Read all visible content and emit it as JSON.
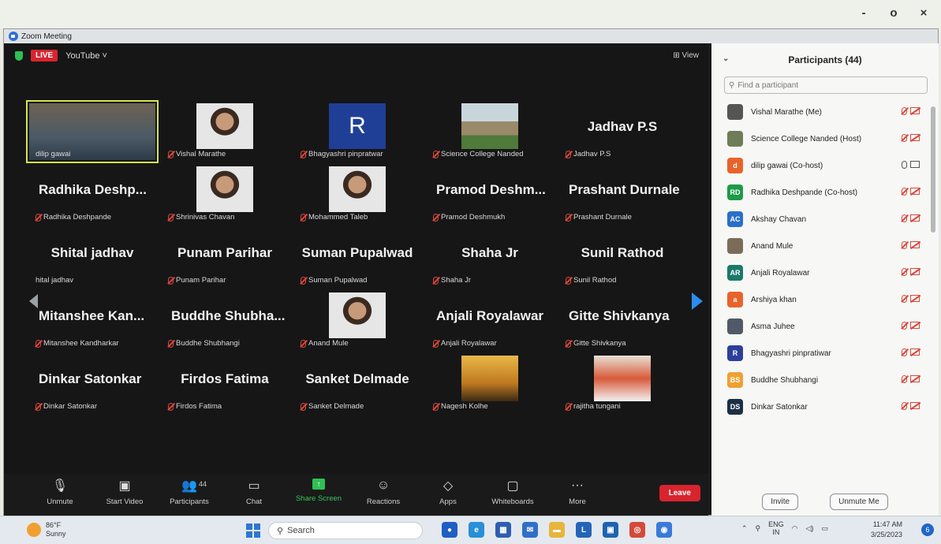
{
  "window": {
    "title": "Zoom Meeting",
    "controls": {
      "minimize": "-",
      "maximize": "o",
      "close": "×"
    }
  },
  "meeting": {
    "live_badge": "LIVE",
    "stream_target": "YouTube ˅",
    "view_label": "⊞ View"
  },
  "grid": {
    "tiles": [
      {
        "type": "video",
        "photo": "self",
        "label": "dilip gawai",
        "active": true,
        "muted": false
      },
      {
        "type": "video",
        "photo": "face",
        "label": "Vishal Marathe",
        "muted": true
      },
      {
        "type": "video",
        "photo": "letter-r",
        "letter": "R",
        "label": "Bhagyashri pinpratwar",
        "muted": true
      },
      {
        "type": "video",
        "photo": "building",
        "label": "Science College Nanded",
        "muted": true
      },
      {
        "type": "name",
        "name": "Jadhav P.S",
        "center": true,
        "label": "Jadhav P.S",
        "muted": true
      },
      {
        "type": "name",
        "name": "Radhika Deshp...",
        "label": "Radhika Deshpande",
        "muted": true
      },
      {
        "type": "video",
        "photo": "face",
        "label": "Shrinivas Chavan",
        "muted": true
      },
      {
        "type": "video",
        "photo": "face",
        "label": "Mohammed Taleb",
        "muted": true
      },
      {
        "type": "name",
        "name": "Pramod Deshm...",
        "label": "Pramod Deshmukh",
        "muted": true
      },
      {
        "type": "name",
        "name": "Prashant Durnale",
        "label": "Prashant Durnale",
        "muted": true
      },
      {
        "type": "name",
        "name": "Shital jadhav",
        "center": true,
        "label": "hital jadhav",
        "muted": false
      },
      {
        "type": "name",
        "name": "Punam Parihar",
        "center": true,
        "label": "Punam Parihar",
        "muted": true
      },
      {
        "type": "name",
        "name": "Suman Pupalwad",
        "center": true,
        "label": "Suman Pupalwad",
        "muted": true
      },
      {
        "type": "name",
        "name": "Shaha Jr",
        "center": true,
        "label": "Shaha Jr",
        "muted": true
      },
      {
        "type": "name",
        "name": "Sunil Rathod",
        "center": true,
        "label": "Sunil Rathod",
        "muted": true
      },
      {
        "type": "name",
        "name": "Mitanshee Kan...",
        "label": "Mitanshee Kandharkar",
        "muted": true
      },
      {
        "type": "name",
        "name": "Buddhe Shubha...",
        "label": "Buddhe Shubhangi",
        "muted": true
      },
      {
        "type": "video",
        "photo": "face",
        "label": "Anand Mule",
        "muted": true
      },
      {
        "type": "name",
        "name": "Anjali Royalawar",
        "label": "Anjali Royalawar",
        "muted": true
      },
      {
        "type": "name",
        "name": "Gitte Shivkanya",
        "label": "Gitte Shivkanya",
        "muted": true
      },
      {
        "type": "name",
        "name": "Dinkar Satonkar",
        "label": "Dinkar Satonkar",
        "muted": true
      },
      {
        "type": "name",
        "name": "Firdos Fatima",
        "center": true,
        "label": "Firdos Fatima",
        "muted": true
      },
      {
        "type": "name",
        "name": "Sanket Delmade",
        "center": true,
        "label": "Sanket Delmade",
        "muted": true
      },
      {
        "type": "video",
        "photo": "karate",
        "label": "Nagesh Kolhe",
        "muted": true
      },
      {
        "type": "video",
        "photo": "stage",
        "label": "rajitha tungani",
        "muted": true
      }
    ]
  },
  "toolbar": {
    "items": [
      {
        "name": "unmute",
        "icon": "🎙",
        "label": "Unmute"
      },
      {
        "name": "start-video",
        "icon": "▣",
        "label": "Start Video"
      },
      {
        "name": "participants",
        "icon": "👥",
        "label": "Participants",
        "count": "44"
      },
      {
        "name": "chat",
        "icon": "▭",
        "label": "Chat"
      },
      {
        "name": "share-screen",
        "icon": "↑",
        "label": "Share Screen"
      },
      {
        "name": "reactions",
        "icon": "☺",
        "label": "Reactions"
      },
      {
        "name": "apps",
        "icon": "◇",
        "label": "Apps"
      },
      {
        "name": "whiteboards",
        "icon": "▢",
        "label": "Whiteboards"
      },
      {
        "name": "more",
        "icon": "···",
        "label": "More"
      }
    ],
    "leave_label": "Leave"
  },
  "participants_panel": {
    "title": "Participants (44)",
    "search_placeholder": "Find a participant",
    "items": [
      {
        "name": "Vishal Marathe (Me)",
        "avatar": "",
        "color": "#555555",
        "mic": "muted",
        "cam": "off"
      },
      {
        "name": "Science College Nanded (Host)",
        "avatar": "",
        "color": "#6f7c5a",
        "mic": "muted",
        "cam": "off"
      },
      {
        "name": "dilip gawai (Co-host)",
        "avatar": "d",
        "color": "#e8632b",
        "mic": "on",
        "cam": "on"
      },
      {
        "name": "Radhika Deshpande (Co-host)",
        "avatar": "RD",
        "color": "#1e9a4a",
        "mic": "muted",
        "cam": "off"
      },
      {
        "name": "Akshay Chavan",
        "avatar": "AC",
        "color": "#2a6fc9",
        "mic": "muted",
        "cam": "off"
      },
      {
        "name": "Anand Mule",
        "avatar": "",
        "color": "#7b6c5a",
        "mic": "muted",
        "cam": "off"
      },
      {
        "name": "Anjali Royalawar",
        "avatar": "AR",
        "color": "#1a7a6a",
        "mic": "muted",
        "cam": "off"
      },
      {
        "name": "Arshiya khan",
        "avatar": "a",
        "color": "#e8632b",
        "mic": "muted",
        "cam": "off"
      },
      {
        "name": "Asma Juhee",
        "avatar": "",
        "color": "#4f5a66",
        "mic": "muted",
        "cam": "off"
      },
      {
        "name": "Bhagyashri pinpratiwar",
        "avatar": "R",
        "color": "#2c3f9a",
        "mic": "muted",
        "cam": "off"
      },
      {
        "name": "Buddhe Shubhangi",
        "avatar": "BS",
        "color": "#f0a032",
        "mic": "muted",
        "cam": "off"
      },
      {
        "name": "Dinkar Satonkar",
        "avatar": "DS",
        "color": "#1d2f45",
        "mic": "muted",
        "cam": "off"
      }
    ],
    "invite_label": "Invite",
    "unmute_me_label": "Unmute Me"
  },
  "taskbar": {
    "weather_temp": "86°F",
    "weather_text": "Sunny",
    "search_label": "Search",
    "apps": [
      {
        "name": "zoom",
        "glyph": "●",
        "color": "#1f5fc4"
      },
      {
        "name": "edge",
        "glyph": "e",
        "color": "#2a8fd6"
      },
      {
        "name": "store",
        "glyph": "▦",
        "color": "#2e5fb0"
      },
      {
        "name": "mail",
        "glyph": "✉",
        "color": "#2f6fc8"
      },
      {
        "name": "explorer",
        "glyph": "▬",
        "color": "#e7b53a"
      },
      {
        "name": "app-l",
        "glyph": "L",
        "color": "#2564b8"
      },
      {
        "name": "app-chat",
        "glyph": "▣",
        "color": "#1e63b0"
      },
      {
        "name": "chrome",
        "glyph": "◎",
        "color": "#d44a3a"
      },
      {
        "name": "zoom-2",
        "glyph": "◉",
        "color": "#3a7ad8"
      }
    ],
    "lang_top": "ENG",
    "lang_bottom": "IN",
    "time": "11:47 AM",
    "date": "3/25/2023",
    "notif_count": "6"
  }
}
